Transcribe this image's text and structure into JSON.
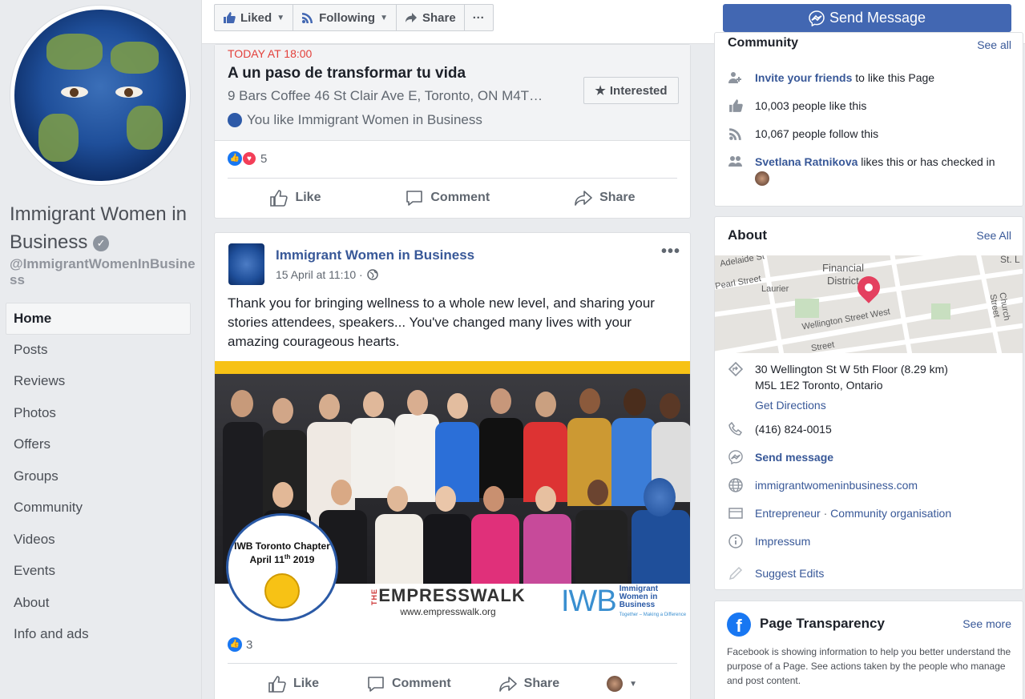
{
  "page": {
    "name": "Immigrant Women in Business",
    "handle": "@ImmigrantWomenInBusiness"
  },
  "nav": [
    "Home",
    "Posts",
    "Reviews",
    "Photos",
    "Offers",
    "Groups",
    "Community",
    "Videos",
    "Events",
    "About",
    "Info and ads"
  ],
  "topbar": {
    "liked": "Liked",
    "following": "Following",
    "share": "Share",
    "more": "···",
    "send_message": "Send Message"
  },
  "event": {
    "date": "TODAY AT 18:00",
    "title": "A un paso de transformar tu vida",
    "location": "9 Bars Coffee 46 St Clair Ave E, Toronto, ON M4T…",
    "like_note": "You like Immigrant Women in Business",
    "interested": "Interested",
    "reaction_count": "5"
  },
  "actions": {
    "like": "Like",
    "comment": "Comment",
    "share": "Share"
  },
  "post": {
    "author": "Immigrant Women in Business",
    "date": "15 April at 11:10 · ",
    "text": "Thank you for bringing wellness to a whole new level, and sharing your stories attendees, speakers... You've changed many lives with your amazing courageous hearts.",
    "photo": {
      "badge_line1": "IWB Toronto Chapter",
      "badge_line2": "April 11",
      "badge_sup": "th",
      "badge_year": " 2019",
      "empress_prefix": "THE",
      "empress": "EMPRESSWALK",
      "empress_url": "www.empresswalk.org",
      "iwb": "IWB",
      "iwb_sub1": "Immigrant",
      "iwb_sub2": "Women in",
      "iwb_sub3": "Business",
      "iwb_tag": "Together – Making a Difference"
    },
    "reaction_count": "3"
  },
  "community": {
    "title": "Community",
    "see_all": "See all",
    "invite_link": "Invite your friends",
    "invite_rest": " to like this Page",
    "likes": "10,003 people like this",
    "follows": "10,067 people follow this",
    "friend_name": "Svetlana Ratnikova",
    "friend_rest": " likes this or has checked in"
  },
  "about": {
    "title": "About",
    "see_all": "See All",
    "map_labels": [
      "Adelaide St",
      "Financial",
      "District",
      "St. L",
      "Pearl Street",
      "Laurier",
      "Wellington Street West",
      "Church Street",
      "Street"
    ],
    "address_line1": "30 Wellington St W 5th Floor (8.29 km)",
    "address_line2": "M5L 1E2 Toronto, Ontario",
    "directions": "Get Directions",
    "phone": "(416) 824-0015",
    "send_message": "Send message",
    "website": "immigrantwomeninbusiness.com",
    "category1": "Entrepreneur",
    "category_sep": " · ",
    "category2": "Community organisation",
    "impressum": "Impressum",
    "suggest": "Suggest Edits"
  },
  "transparency": {
    "title": "Page Transparency",
    "see_more": "See more",
    "text": "Facebook is showing information to help you better understand the purpose of a Page. See actions taken by the people who manage and post content."
  },
  "colors": {
    "brand": "#4267b2",
    "link": "#385898",
    "event_date": "#e3403b"
  }
}
